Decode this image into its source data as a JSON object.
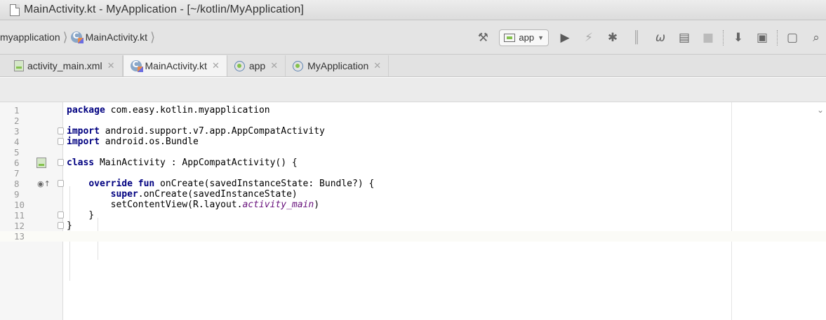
{
  "window": {
    "title": "MainActivity.kt - MyApplication - [~/kotlin/MyApplication]"
  },
  "breadcrumbs": [
    "myapplication",
    "MainActivity.kt"
  ],
  "toolbar": {
    "run_config": "app",
    "icons": [
      "hammer-icon",
      "run-icon",
      "lightning-icon",
      "debug-bug-icon",
      "attach-debugger-icon",
      "profiler-icon",
      "apply-changes-icon",
      "stop-icon",
      "sync-gradle-icon",
      "sdk-manager-icon",
      "device-manager-icon",
      "search-icon"
    ]
  },
  "tabs": [
    {
      "label": "activity_main.xml",
      "icon": "layout-xml-icon",
      "active": false
    },
    {
      "label": "MainActivity.kt",
      "icon": "kotlin-class-icon",
      "active": true
    },
    {
      "label": "app",
      "icon": "module-icon",
      "active": false
    },
    {
      "label": "MyApplication",
      "icon": "module-icon",
      "active": false
    }
  ],
  "editor": {
    "lines": [
      {
        "n": "1",
        "tokens": [
          {
            "t": "package",
            "k": "kw"
          },
          {
            "t": " com.easy.kotlin.myapplication"
          }
        ]
      },
      {
        "n": "2",
        "tokens": []
      },
      {
        "n": "3",
        "tokens": [
          {
            "t": "import",
            "k": "kw"
          },
          {
            "t": " android.support.v7.app.AppCompatActivity"
          }
        ]
      },
      {
        "n": "4",
        "tokens": [
          {
            "t": "import",
            "k": "kw"
          },
          {
            "t": " android.os.Bundle"
          }
        ]
      },
      {
        "n": "5",
        "tokens": []
      },
      {
        "n": "6",
        "tokens": [
          {
            "t": "class",
            "k": "kw"
          },
          {
            "t": " MainActivity : AppCompatActivity() {"
          }
        ]
      },
      {
        "n": "7",
        "tokens": []
      },
      {
        "n": "8",
        "tokens": [
          {
            "t": "    "
          },
          {
            "t": "override fun",
            "k": "kw"
          },
          {
            "t": " onCreate(savedInstanceState: Bundle?) {"
          }
        ]
      },
      {
        "n": "9",
        "tokens": [
          {
            "t": "        "
          },
          {
            "t": "super",
            "k": "kw"
          },
          {
            "t": ".onCreate(savedInstanceState)"
          }
        ]
      },
      {
        "n": "10",
        "tokens": [
          {
            "t": "        setContentView(R.layout."
          },
          {
            "t": "activity_main",
            "k": "it"
          },
          {
            "t": ")"
          }
        ]
      },
      {
        "n": "11",
        "tokens": [
          {
            "t": "    }"
          }
        ]
      },
      {
        "n": "12",
        "tokens": [
          {
            "t": "}"
          }
        ]
      },
      {
        "n": "13",
        "tokens": []
      }
    ]
  }
}
